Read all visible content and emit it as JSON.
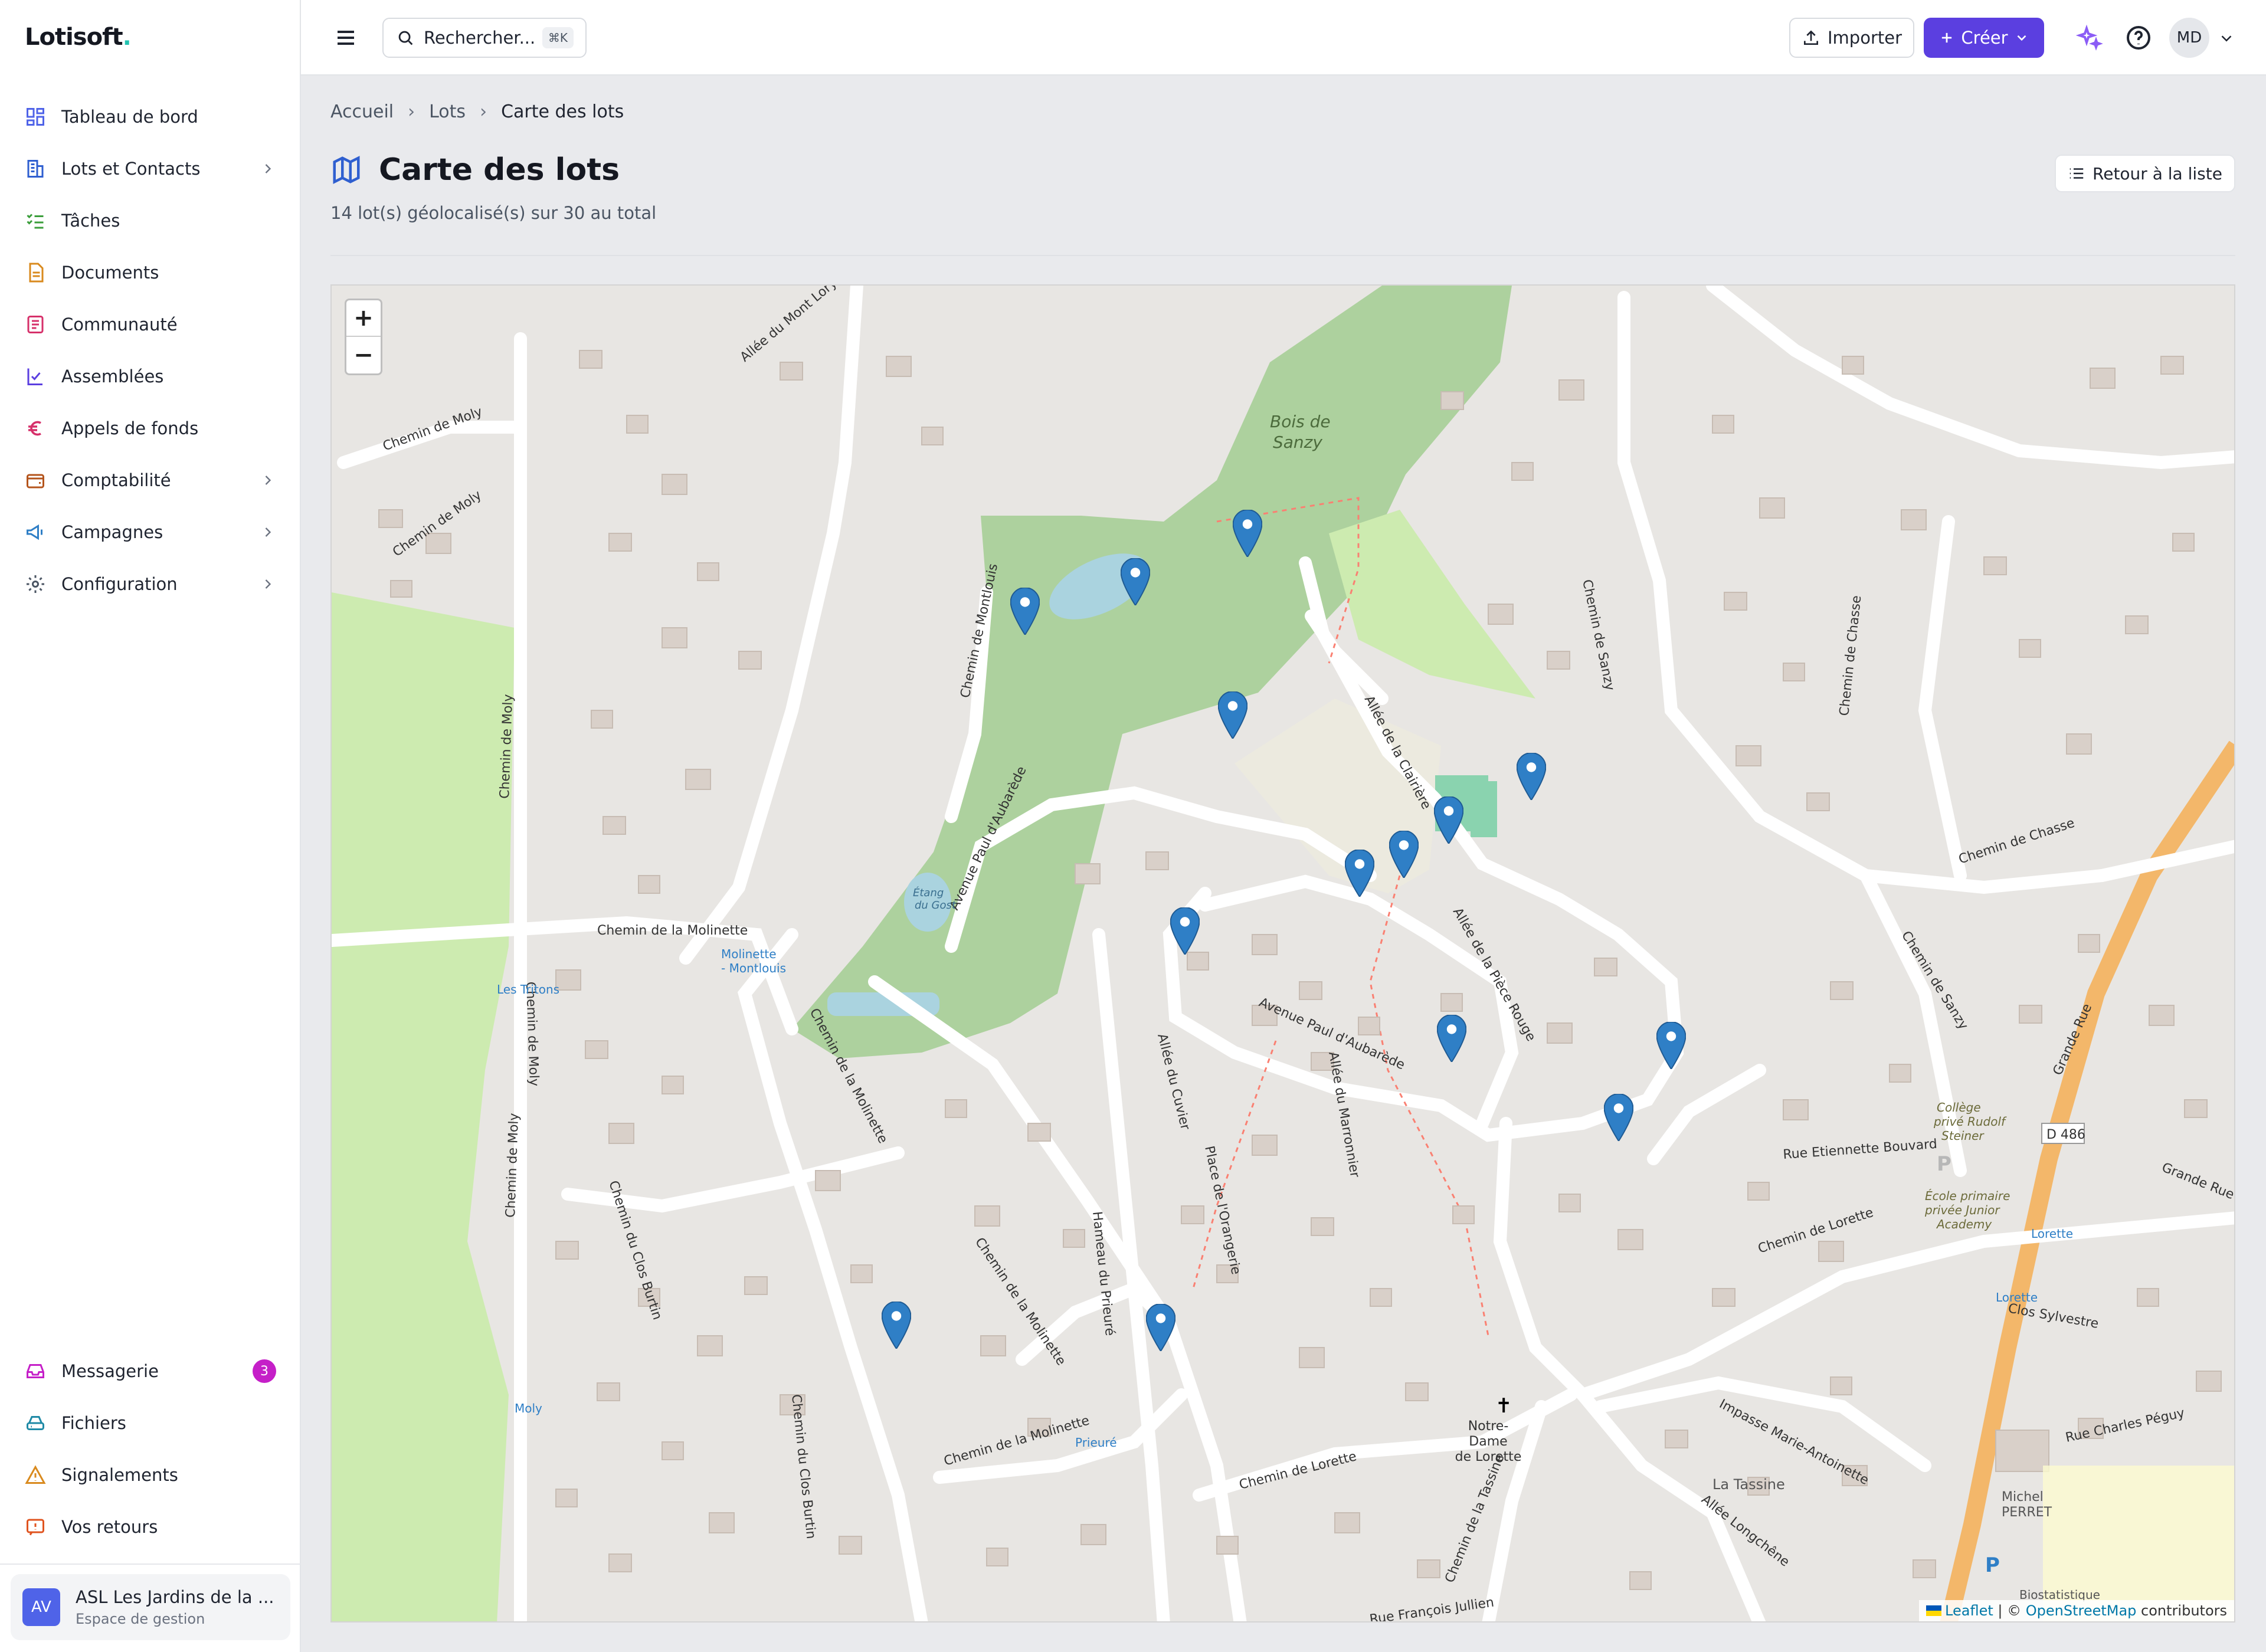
{
  "app": {
    "name": "Lotisoft",
    "logo_dot": "."
  },
  "sidebar": {
    "items": [
      {
        "label": "Tableau de bord",
        "icon": "dashboard-icon"
      },
      {
        "label": "Lots et Contacts",
        "icon": "building-icon",
        "has_children": true
      },
      {
        "label": "Tâches",
        "icon": "checklist-icon"
      },
      {
        "label": "Documents",
        "icon": "document-icon"
      },
      {
        "label": "Communauté",
        "icon": "community-icon"
      },
      {
        "label": "Assemblées",
        "icon": "vote-icon"
      },
      {
        "label": "Appels de fonds",
        "icon": "euro-icon"
      },
      {
        "label": "Comptabilité",
        "icon": "wallet-icon",
        "has_children": true
      },
      {
        "label": "Campagnes",
        "icon": "megaphone-icon",
        "has_children": true
      },
      {
        "label": "Configuration",
        "icon": "gear-icon",
        "has_children": true
      }
    ],
    "bottom_items": [
      {
        "label": "Messagerie",
        "icon": "inbox-icon",
        "badge": "3"
      },
      {
        "label": "Fichiers",
        "icon": "drive-icon"
      },
      {
        "label": "Signalements",
        "icon": "warning-icon"
      },
      {
        "label": "Vos retours",
        "icon": "feedback-icon"
      }
    ],
    "org": {
      "initials": "AV",
      "name": "ASL Les Jardins de la ...",
      "subtitle": "Espace de gestion"
    }
  },
  "topbar": {
    "search_placeholder": "Rechercher...",
    "search_shortcut": "⌘K",
    "import_label": "Importer",
    "create_label": "Créer",
    "user_initials": "MD"
  },
  "breadcrumb": [
    "Accueil",
    "Lots",
    "Carte des lots"
  ],
  "page": {
    "title": "Carte des lots",
    "subtitle": "14 lot(s) géolocalisé(s) sur 30 au total",
    "back_label": "Retour à la liste"
  },
  "map": {
    "zoom_in": "+",
    "zoom_out": "−",
    "attribution_leaflet": "Leaflet",
    "attribution_sep": " | © ",
    "attribution_osm": "OpenStreetMap",
    "attribution_tail": " contributors",
    "labels": [
      "Bois de Sanzy",
      "Chemin de Moly",
      "Chemin de la Molinette",
      "Avenue Paul d'Aubarède",
      "Allée de la Clairière",
      "Allée de la Pièce Rouge",
      "Chemin de Sanzy",
      "Chemin de Chasse",
      "Grande Rue",
      "Chemin de Lorette",
      "Rue Etiennette Bouvard",
      "Clos Sylvestre",
      "Impasse Marie-Antoinette",
      "Allée Longchêne",
      "Rue Charles Péguy",
      "La Tassine",
      "Chemin du Clos Burtin",
      "Hameau du Prieuré",
      "Allée du Marronnier",
      "Allée du Cuvier",
      "Place de l'Orangerie",
      "Allée du Mont Lory",
      "Chemin de Montlouis",
      "Notre-Dame de Lorette",
      "Collège privé Rudolf Steiner",
      "École primaire privée Junior Academy",
      "Michel PERRET",
      "Biostatistique",
      "Molinette - Montlouis",
      "Les Tritons",
      "Moly",
      "Prieuré",
      "Lorette",
      "Étang du Gost",
      "Chemin de la Tassine",
      "Rue François Jullien",
      "D 486"
    ],
    "marker_count": 14,
    "colors": {
      "marker": "#2f7fc6",
      "forest": "#add19e",
      "road": "#ffffff",
      "building": "#d9d0c9",
      "trunk": "#f3b76a"
    }
  },
  "colors": {
    "accent": "#5b3fe0",
    "badge": "#c51fc8",
    "org_avatar": "#4f63e8"
  }
}
